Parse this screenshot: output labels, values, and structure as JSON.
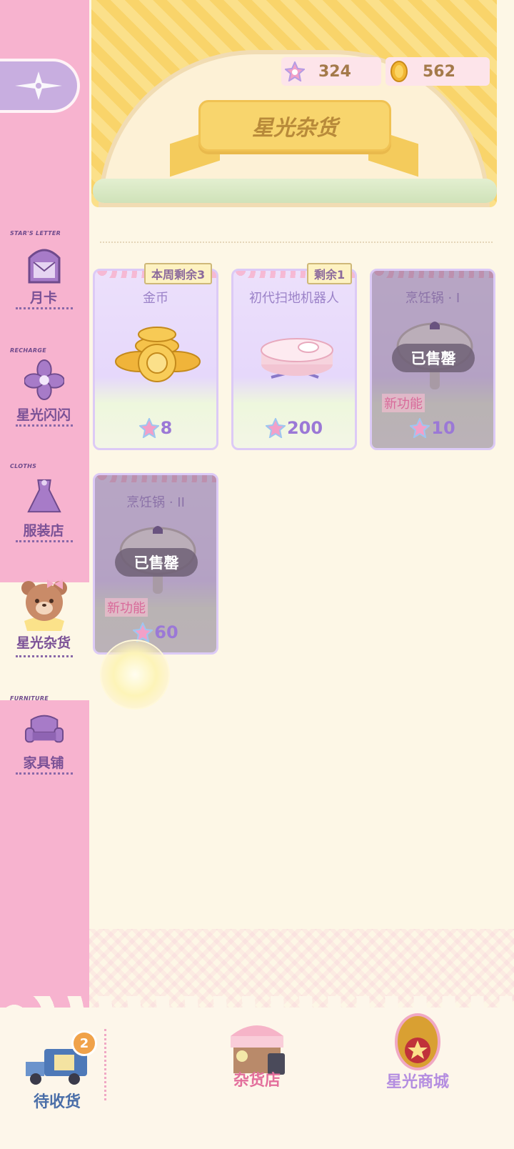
{
  "colors": {
    "sidebar": "#f7b3cf",
    "accent_purple": "#7a5196",
    "header_yellow": "#f9d46a",
    "card_purple": "#e6d8fb"
  },
  "header": {
    "title": "星光杂货",
    "currencies": [
      {
        "icon": "rainbow-star-icon",
        "value": "324"
      },
      {
        "icon": "gold-coin-icon",
        "value": "562"
      }
    ]
  },
  "sidebar": {
    "back_icon": "compass-star-icon",
    "items": [
      {
        "tag": "STAR'S LETTER",
        "label": "月卡",
        "icon": "letter-window-icon"
      },
      {
        "tag": "RECHARGE",
        "label": "星光闪闪",
        "icon": "flower-icon"
      },
      {
        "tag": "CLOTHS",
        "label": "服装店",
        "icon": "dress-icon"
      },
      {
        "tag": "",
        "label": "星光杂货",
        "icon": "bear-avatar-icon"
      },
      {
        "tag": "FURNITURE",
        "label": "家具铺",
        "icon": "sofa-icon"
      }
    ]
  },
  "shop": {
    "items": [
      {
        "name": "金币",
        "badge": "本周剩余3",
        "price": "8",
        "image": "gold-coins-icon",
        "sold_out": false
      },
      {
        "name": "初代扫地机器人",
        "badge": "剩余1",
        "price": "200",
        "image": "robot-vacuum-icon",
        "sold_out": false
      },
      {
        "name": "烹饪锅 · I",
        "badge": "",
        "price": "10",
        "image": "cooking-pot-icon",
        "sold_out": true,
        "sold_label": "已售罄",
        "new_label": "新功能"
      },
      {
        "name": "烹饪锅 · II",
        "badge": "",
        "price": "60",
        "image": "cooking-pot-icon",
        "sold_out": true,
        "sold_label": "已售罄",
        "new_label": "新功能"
      }
    ]
  },
  "bottom_nav": {
    "items": [
      {
        "label": "待收货",
        "icon": "delivery-truck-icon",
        "badge": "2"
      },
      {
        "label": "杂货店",
        "icon": "grocery-stall-icon"
      },
      {
        "label": "星光商城",
        "icon": "star-mall-icon"
      }
    ]
  }
}
